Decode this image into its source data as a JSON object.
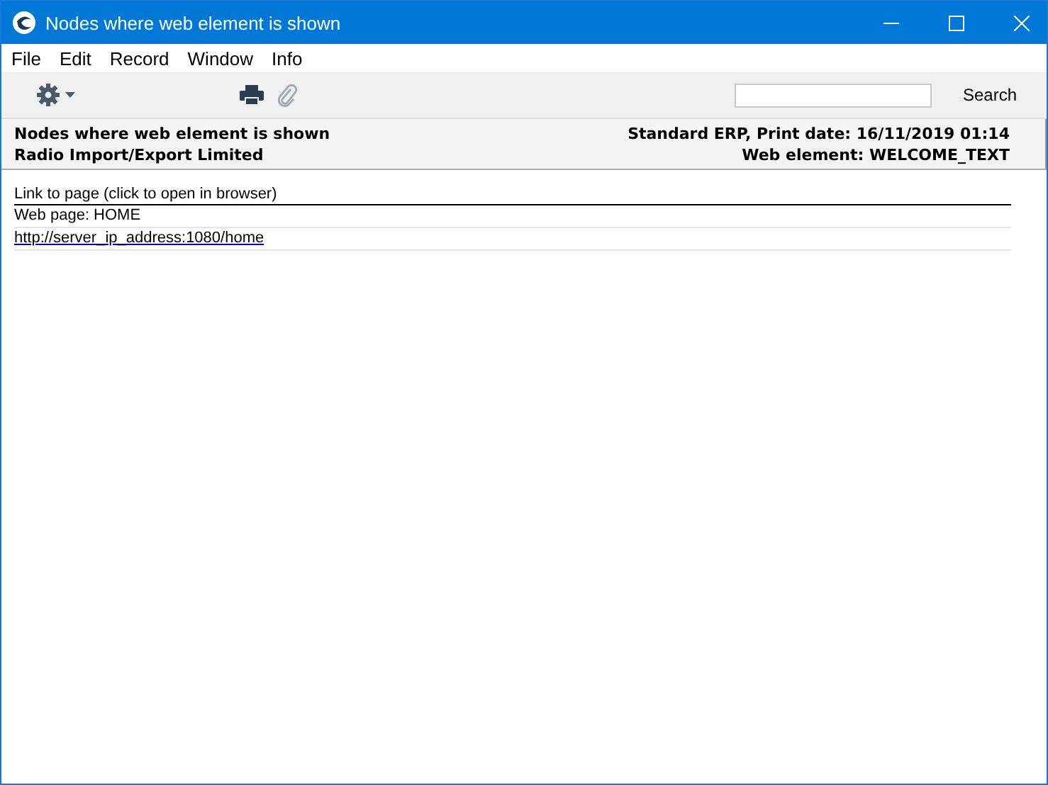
{
  "window": {
    "title": "Nodes where web element is shown"
  },
  "menu": [
    "File",
    "Edit",
    "Record",
    "Window",
    "Info"
  ],
  "search": {
    "button": "Search"
  },
  "header": {
    "left": [
      "Nodes where web element is shown",
      "Radio Import/Export Limited"
    ],
    "right": [
      "Standard ERP, Print date: 16/11/2019 01:14",
      "Web element: WELCOME_TEXT"
    ]
  },
  "report": {
    "column_heading": "Link to page (click to open in browser)",
    "rows": [
      {
        "kind": "text",
        "text": "Web page: HOME"
      },
      {
        "kind": "link",
        "text": "http://server_ip_address:1080/home"
      }
    ]
  }
}
